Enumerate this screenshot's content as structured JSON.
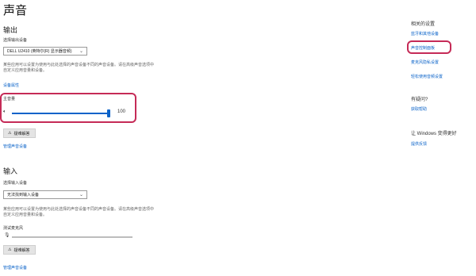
{
  "page": {
    "title": "声音"
  },
  "output": {
    "heading": "输出",
    "device_label": "选择输出设备",
    "device_value": "DELL U2410 (英特尔(R) 显示器音频)",
    "desc": "某些应用可以设置为使用与此处选择的声音设备不同的声音设备。请在高级声音选项中自定义应用音量和设备。",
    "props_link": "设备属性",
    "volume_label": "主音量",
    "volume_value": "100",
    "volume_fraction": 1.0,
    "troubleshoot_label": "疑难解答",
    "manage_link": "管理声音设备"
  },
  "input": {
    "heading": "输入",
    "device_label": "选择输入设备",
    "device_value": "无法找到输入设备",
    "desc": "某些应用可以设置为使用与此处选择的声音设备不同的声音设备。请在高级声音选项中自定义应用音量和设备。",
    "mic_label": "测试麦克风",
    "mic_fraction": 0.0,
    "troubleshoot_label": "疑难解答",
    "manage_link": "管理声音设备"
  },
  "related": {
    "heading": "相关的设置",
    "links": [
      "蓝牙和其他设备",
      "声音控制面板",
      "麦克风隐私设置",
      "轻松使用音频设置"
    ]
  },
  "help": {
    "heading": "有疑问?",
    "link": "获取帮助"
  },
  "improve": {
    "heading": "让 Windows 变得更好",
    "link": "提供反馈"
  },
  "icons": {
    "speaker": "speaker-icon",
    "mic": "microphone-icon",
    "warning": "warning-icon",
    "chevron": "chevron-down-icon"
  },
  "colors": {
    "accent": "#0b63c9",
    "highlight": "#c52b57",
    "button_bg": "#e4e4e4"
  }
}
